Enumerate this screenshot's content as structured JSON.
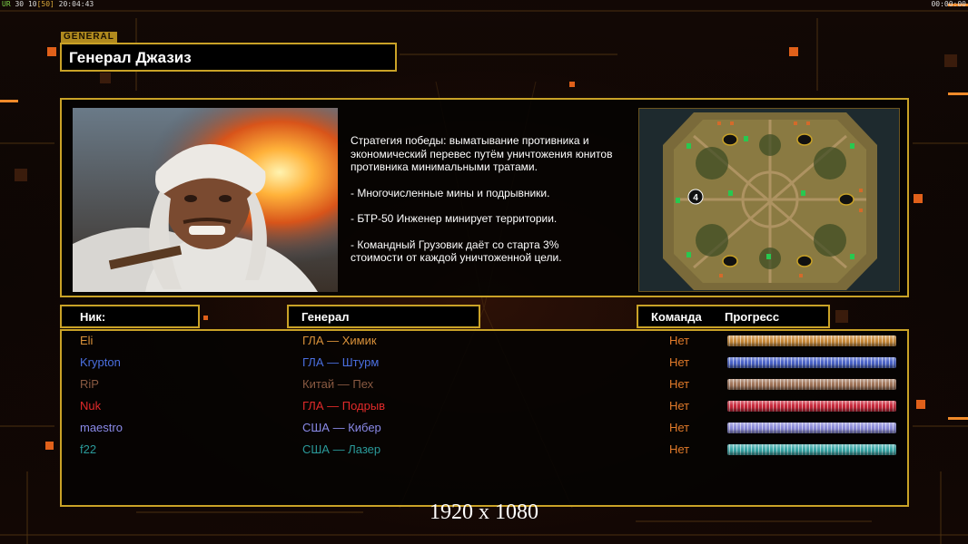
{
  "hud": {
    "top_left_a": "UR",
    "top_left_b": "30",
    "top_left_c": "10",
    "top_left_d": "[50]",
    "top_left_time": "20:04:43",
    "top_right_time": "00:00:00"
  },
  "section_tag": "GENERAL",
  "title": "Генерал Джазиз",
  "description": [
    "Стратегия победы: выматывание противника и\n экономический перевес путём уничтожения юнитов\n противника минимальными тратами.",
    "- Многочисленные мины и подрывники.",
    "- БТР-50 Инженер минирует территории.",
    "- Командный Грузовик даёт со старта 3%\n  стоимости от каждой уничтоженной цели."
  ],
  "minimap": {
    "start_label": "4"
  },
  "columns": {
    "nick": "Ник:",
    "general": "Генерал",
    "team": "Команда",
    "progress": "Прогресс"
  },
  "players": [
    {
      "nick": "Eli",
      "general": "ГЛА — Химик",
      "team": "Нет",
      "color": "#d9913a",
      "bar": "#c88a3a"
    },
    {
      "nick": "Krypton",
      "general": "ГЛА — Штурм",
      "team": "Нет",
      "color": "#4a6fe0",
      "bar": "#4a63c8"
    },
    {
      "nick": "RiP",
      "general": "Китай — Пех",
      "team": "Нет",
      "color": "#8a5a42",
      "bar": "#a07458"
    },
    {
      "nick": "Nuk",
      "general": "ГЛА — Подрыв",
      "team": "Нет",
      "color": "#e02a2a",
      "bar": "#c8283a"
    },
    {
      "nick": "maestro",
      "general": "США — Кибер",
      "team": "Нет",
      "color": "#8a8ae8",
      "bar": "#8a8ad8"
    },
    {
      "nick": "f22",
      "general": "США — Лазер",
      "team": "Нет",
      "color": "#2a9a9a",
      "bar": "#3aa6a6"
    }
  ],
  "team_color": "#e07a2a",
  "footer_resolution": "1920 x 1080"
}
